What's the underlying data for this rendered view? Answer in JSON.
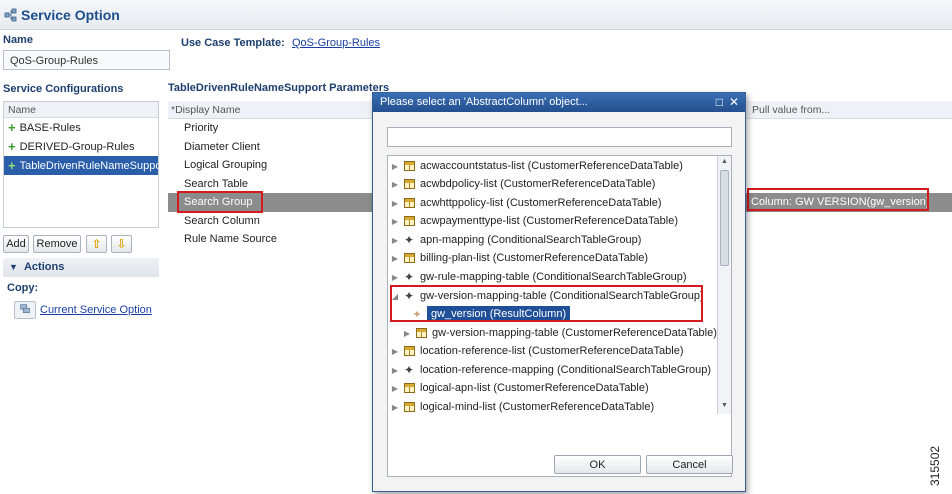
{
  "header": {
    "title": "Service Option",
    "icon": "service-option-icon"
  },
  "name_section": {
    "label": "Name",
    "value": "QoS-Group-Rules"
  },
  "use_case": {
    "label": "Use Case Template:",
    "link": "QoS-Group-Rules"
  },
  "service_configurations": {
    "title": "Service Configurations",
    "column_header": "Name",
    "items": [
      {
        "label": "BASE-Rules",
        "selected": false
      },
      {
        "label": "DERIVED-Group-Rules",
        "selected": false
      },
      {
        "label": "TableDrivenRuleNameSupport",
        "selected": true
      }
    ],
    "buttons": {
      "add": "Add",
      "remove": "Remove"
    }
  },
  "actions": {
    "title": "Actions",
    "copy_label": "Copy:",
    "current_service_option": "Current Service Option"
  },
  "parameters": {
    "title": "TableDrivenRuleNameSupport Parameters",
    "col_display_name": "*Display Name",
    "col_pull_value": "Pull value from...",
    "rows": [
      {
        "name": "Priority"
      },
      {
        "name": "Diameter Client"
      },
      {
        "name": "Logical Grouping"
      },
      {
        "name": "Search Table"
      },
      {
        "name": "Search Group",
        "selected": true
      },
      {
        "name": "Search Column"
      },
      {
        "name": "Rule Name Source"
      }
    ],
    "search_group_value": "Column: GW VERSION(gw_version)"
  },
  "dialog": {
    "title": "Please select an 'AbstractColumn' object...",
    "filter_value": "",
    "tree": [
      {
        "label": "acwaccountstatus-list (CustomerReferenceDataTable)",
        "icon": "table-icon",
        "indent": 0,
        "twisty": "collapsed"
      },
      {
        "label": "acwbdpolicy-list (CustomerReferenceDataTable)",
        "icon": "table-icon",
        "indent": 0,
        "twisty": "collapsed"
      },
      {
        "label": "acwhttppolicy-list (CustomerReferenceDataTable)",
        "icon": "table-icon",
        "indent": 0,
        "twisty": "collapsed"
      },
      {
        "label": "acwpaymenttype-list (CustomerReferenceDataTable)",
        "icon": "table-icon",
        "indent": 0,
        "twisty": "collapsed"
      },
      {
        "label": "apn-mapping (ConditionalSearchTableGroup)",
        "icon": "group-icon",
        "indent": 0,
        "twisty": "collapsed"
      },
      {
        "label": "billing-plan-list (CustomerReferenceDataTable)",
        "icon": "table-icon",
        "indent": 0,
        "twisty": "collapsed"
      },
      {
        "label": "gw-rule-mapping-table (ConditionalSearchTableGroup)",
        "icon": "group-icon",
        "indent": 0,
        "twisty": "collapsed"
      },
      {
        "label": "gw-version-mapping-table (ConditionalSearchTableGroup)",
        "icon": "group-icon",
        "indent": 0,
        "twisty": "expanded"
      },
      {
        "label": "gw_version (ResultColumn)",
        "icon": "result-column-icon",
        "indent": 1,
        "twisty": "none",
        "selected": true
      },
      {
        "label": "gw-version-mapping-table (CustomerReferenceDataTable)",
        "icon": "table-icon",
        "indent": 1,
        "twisty": "collapsed"
      },
      {
        "label": "location-reference-list (CustomerReferenceDataTable)",
        "icon": "table-icon",
        "indent": 0,
        "twisty": "collapsed"
      },
      {
        "label": "location-reference-mapping (ConditionalSearchTableGroup)",
        "icon": "group-icon",
        "indent": 0,
        "twisty": "collapsed"
      },
      {
        "label": "logical-apn-list (CustomerReferenceDataTable)",
        "icon": "table-icon",
        "indent": 0,
        "twisty": "collapsed"
      },
      {
        "label": "logical-mind-list (CustomerReferenceDataTable)",
        "icon": "table-icon",
        "indent": 0,
        "twisty": "collapsed"
      }
    ],
    "ok_label": "OK",
    "cancel_label": "Cancel"
  },
  "figure_id": "315502",
  "colors": {
    "accent": "#1d4e8c",
    "highlight": "#d6191f",
    "selection": "#1f4f98"
  }
}
